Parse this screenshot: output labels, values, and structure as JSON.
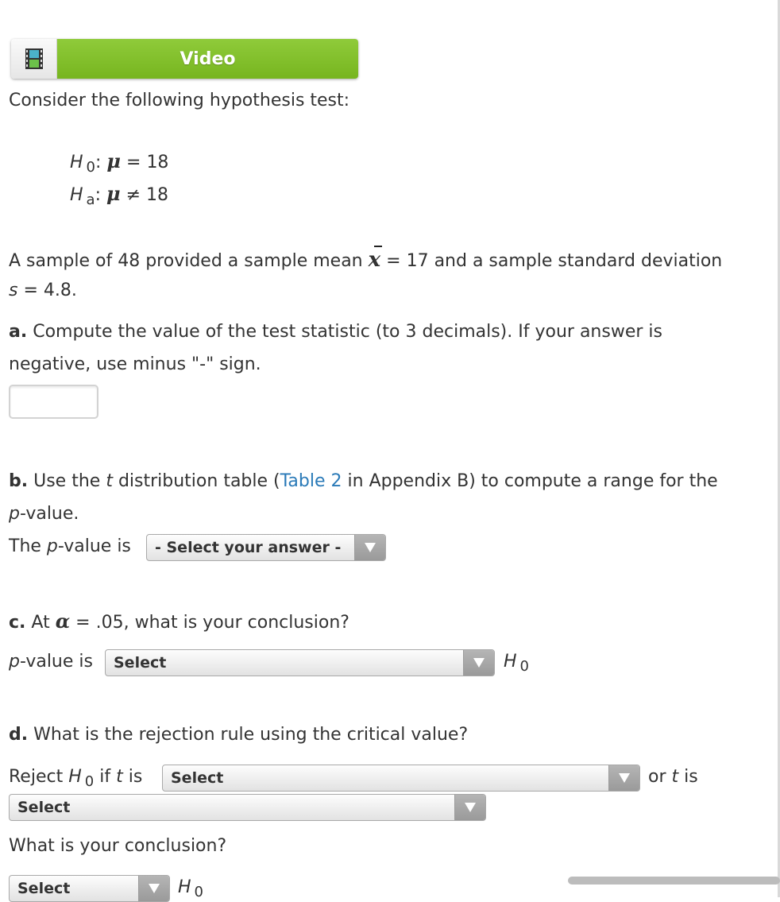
{
  "video_button": {
    "label": "Video",
    "icon": "film-strip-icon",
    "color": "#7fbd27"
  },
  "intro": "Consider the following hypothesis test:",
  "hypotheses": {
    "null": {
      "symbol": "H",
      "subscript": "0",
      "colon": ":",
      "mu": "μ",
      "relation": "=",
      "value": "18"
    },
    "alt": {
      "symbol": "H",
      "subscript": "a",
      "colon": ":",
      "mu": "μ",
      "relation": "≠",
      "value": "18"
    }
  },
  "sample_text": {
    "part1": "A sample of 48 provided a sample mean",
    "xbar": "x",
    "part2": "= 17 and a sample standard deviation",
    "s_symbol": "s",
    "s_value": "= 4.8."
  },
  "part_a": {
    "label": "a.",
    "line1": "Compute the value of the test statistic (to 3 decimals). If your answer is",
    "line2": "negative, use minus \"-\" sign.",
    "input_value": ""
  },
  "part_b": {
    "label": "b.",
    "text1": "Use the",
    "t": "t",
    "text2": "distribution table (",
    "link": "Table 2",
    "text3": "in Appendix B) to compute a range for the",
    "p": "p",
    "text4": "-value.",
    "prompt_the": "The",
    "prompt_p": "p",
    "prompt_rest": "-value is",
    "select_value": "- Select your answer -"
  },
  "part_c": {
    "label": "c.",
    "text1": "At",
    "alpha": "α",
    "text2": "= .05, what is your conclusion?",
    "prompt_p": "p",
    "prompt_rest": "-value is",
    "select_value": "Select",
    "h": "H",
    "h_sub": "0"
  },
  "part_d": {
    "label": "d.",
    "question": "What is the rejection rule using the critical value?",
    "reject": "Reject",
    "h": "H",
    "h_sub": "0",
    "if": "if",
    "t": "t",
    "is": "is",
    "select1_value": "Select",
    "or": "or",
    "select2_value": "Select",
    "conclusion_q": "What is your conclusion?",
    "select3_value": "Select"
  }
}
